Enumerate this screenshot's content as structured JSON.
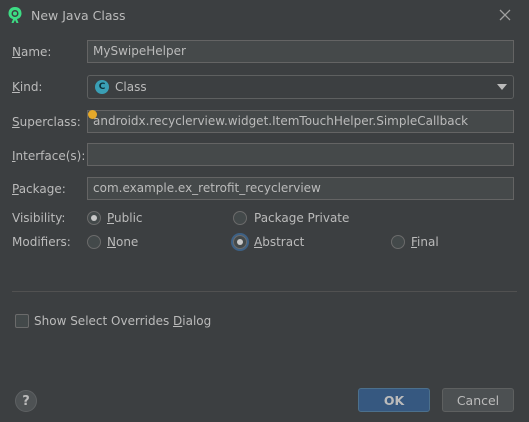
{
  "window": {
    "title": "New Java Class"
  },
  "form": {
    "name": {
      "label_first": "N",
      "label_rest": "ame:",
      "value": "MySwipeHelper"
    },
    "kind": {
      "label_first": "K",
      "label_rest": "ind:",
      "value": "Class",
      "icon_letter": "C"
    },
    "superclass": {
      "label_first": "S",
      "label_rest": "uperclass:",
      "value": "androidx.recyclerview.widget.ItemTouchHelper.SimpleCallback"
    },
    "interfaces": {
      "label_first": "I",
      "label_rest": "nterface(s):",
      "value": ""
    },
    "package": {
      "label_first": "P",
      "label_rest": "ackage:",
      "value": "com.example.ex_retrofit_recyclerview"
    },
    "visibility": {
      "label": "Visibility:",
      "options": [
        {
          "first": "",
          "mn": "P",
          "rest": "ublic",
          "selected": true
        },
        {
          "first": "",
          "mn": "",
          "rest": "Package Private",
          "selected": false
        }
      ]
    },
    "modifiers": {
      "label": "Modifiers:",
      "options": [
        {
          "first": "",
          "mn": "N",
          "rest": "one",
          "selected": false
        },
        {
          "first": "",
          "mn": "A",
          "rest": "bstract",
          "selected": true
        },
        {
          "first": "",
          "mn": "F",
          "rest": "inal",
          "selected": false
        }
      ]
    }
  },
  "overrides": {
    "pre": "Show Select Overrides ",
    "mn": "D",
    "rest": "ialog",
    "checked": false
  },
  "buttons": {
    "help": "?",
    "ok": "OK",
    "cancel": "Cancel"
  },
  "colors": {
    "background": "#3c3f41",
    "field": "#45494a",
    "ok_button": "#365880",
    "class_icon": "#3a9fb5",
    "warning_dot": "#e4a82a"
  }
}
